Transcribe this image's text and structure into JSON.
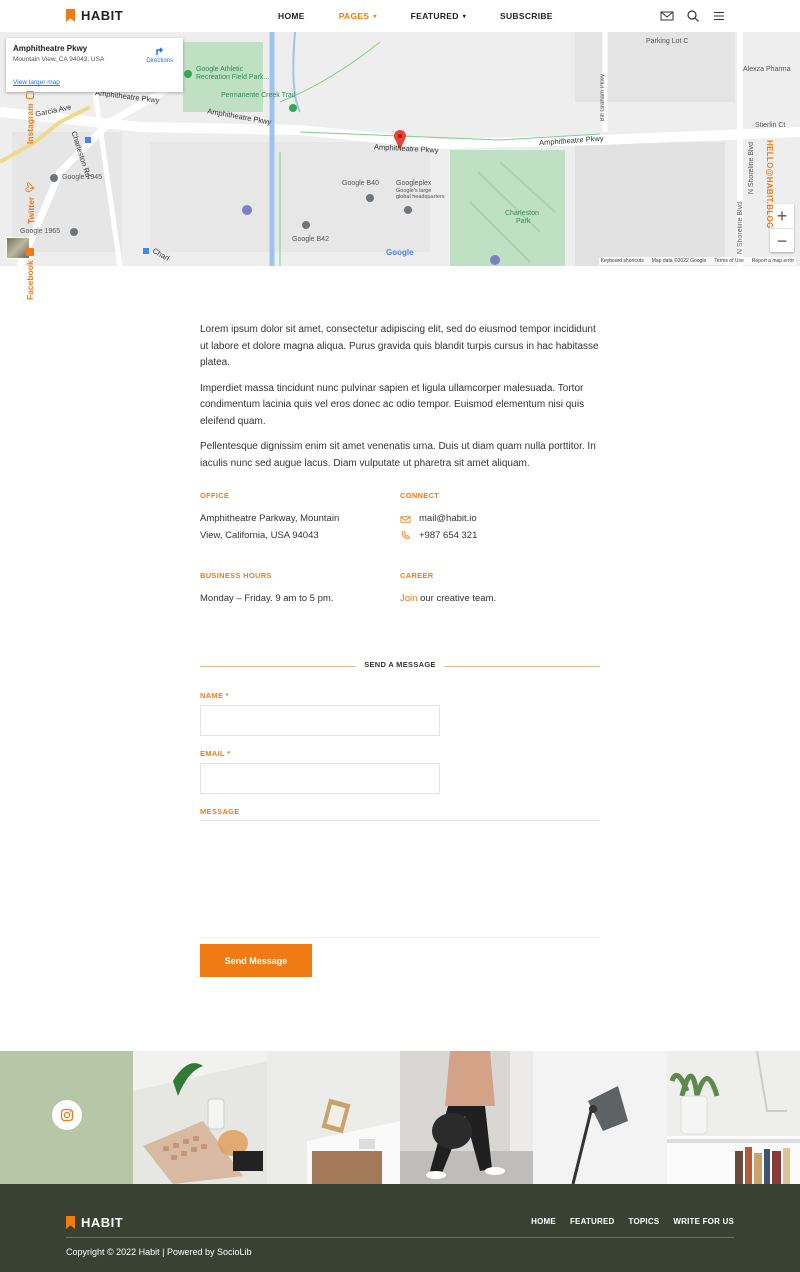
{
  "header": {
    "logo_text": "HABIT",
    "nav": [
      {
        "label": "HOME",
        "caret": false,
        "active": false
      },
      {
        "label": "PAGES",
        "caret": true,
        "active": true
      },
      {
        "label": "FEATURED",
        "caret": true,
        "active": false
      },
      {
        "label": "SUBSCRIBE",
        "caret": false,
        "active": false
      }
    ],
    "icons": [
      "mail-icon",
      "search-icon",
      "menu-icon"
    ]
  },
  "map": {
    "card_title": "Amphitheatre Pkwy",
    "card_address": "Mountain View, CA 94043, USA",
    "card_link": "View larger map",
    "directions": "Directions",
    "labels": {
      "google_athletic": "Google Athletic",
      "recreation": "Recreation Field Park...",
      "parking": "Parking Lot C",
      "alexza": "Alexza Pharma",
      "creek": "Permanente Creek Trail",
      "amph1": "Amphitheatre Pkwy",
      "amph2": "Amphitheatre Pkwy",
      "amph3": "Amphitheatre Pkwy",
      "amph4": "Amphitheatre Pkwy",
      "garcia": "Garcia Ave",
      "charleston_rd": "Charleston Rd",
      "google1945": "Google 1945",
      "google1965": "Google 1965",
      "googleb40": "Google B40",
      "googleb42": "Google B42",
      "googleplex": "Googleplex",
      "googleplex_sub": "Google's large",
      "googleplex_sub2": "global headquarters",
      "charleston_park": "Charleston",
      "charleston_park2": "Park",
      "stierlin": "Stierlin Ct",
      "shoreline": "N Shoreline Blvd",
      "shoreline2": "N Shoreline Blvd",
      "bill_graham": "Bill Graham Pkwy",
      "charl": "Charl"
    },
    "google_logo": "Google",
    "footer": [
      "Keyboard shortcuts",
      "Map data ©2022 Google",
      "Terms of Use",
      "Report a map error"
    ],
    "zoom_in": "+",
    "zoom_out": "−"
  },
  "side": {
    "instagram": "Instagram",
    "twitter": "Twitter",
    "facebook": "Facebook",
    "hello": "HELLO@HABIT.BLOG"
  },
  "content": {
    "paragraphs": [
      "Lorem ipsum dolor sit amet, consectetur adipiscing elit, sed do eiusmod tempor incididunt ut labore et dolore magna aliqua. Purus gravida quis blandit turpis cursus in hac habitasse platea.",
      "Imperdiet massa tincidunt nunc pulvinar sapien et ligula ullamcorper malesuada. Tortor condimentum lacinia quis vel eros donec ac odio tempor. Euismod elementum nisi quis eleifend quam.",
      "Pellentesque dignissim enim sit amet venenatis urna. Duis ut diam quam nulla porttitor. In iaculis nunc sed augue lacus. Diam vulputate ut pharetra sit amet aliquam."
    ],
    "office_heading": "OFFICE",
    "office_address_1": "Amphitheatre Parkway, Mountain",
    "office_address_2": "View, California, USA 94043",
    "connect_heading": "CONNECT",
    "email": "mail@habit.io",
    "phone": "+987 654 321",
    "hours_heading": "BUSINESS HOURS",
    "hours": "Monday – Friday. 9 am to 5 pm.",
    "career_heading": "CAREER",
    "career_link": "Join",
    "career_text": " our creative team."
  },
  "form": {
    "title": "SEND A MESSAGE",
    "name_label": "NAME *",
    "email_label": "EMAIL *",
    "message_label": "MESSAGE",
    "name_value": "",
    "email_value": "",
    "message_value": "",
    "submit": "Send Message"
  },
  "instagram_strip": {
    "icon": "instagram-icon",
    "tiles": [
      "keyboard-desk-photo",
      "side-table-photo",
      "walking-woman-photo",
      "desk-lamp-photo",
      "shelf-plant-photo"
    ]
  },
  "footer": {
    "logo_text": "HABIT",
    "nav": [
      "HOME",
      "FEATURED",
      "TOPICS",
      "WRITE FOR US"
    ],
    "copyright": "Copyright © 2022 Habit | Powered by SocioLib"
  },
  "colors": {
    "accent": "#f07b14",
    "footer_bg": "#394232",
    "strip_green": "#b6c6a6"
  }
}
